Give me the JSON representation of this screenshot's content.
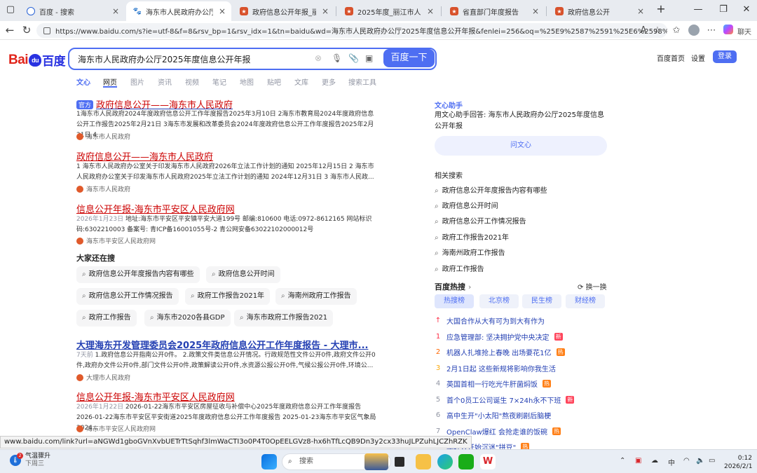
{
  "tabs": [
    {
      "title": "百度 - 搜索",
      "favicon": "search"
    },
    {
      "title": "海东市人民政府办公厅2025年度信息公开年报",
      "favicon": "baidu"
    },
    {
      "title": "政府信息公开年报_丽江市人民政府",
      "favicon": "gov"
    },
    {
      "title": "2025年度_丽江市人民政府",
      "favicon": "gov"
    },
    {
      "title": "省直部门年度报告",
      "favicon": "gov"
    },
    {
      "title": "政府信息公开",
      "favicon": "gov"
    }
  ],
  "address": {
    "url": "https://www.baidu.com/s?ie=utf-8&f=8&rsv_bp=1&rsv_idx=1&tn=baidu&wd=海东市人民政府办公厅2025年度信息公开年报&fenlei=256&oq=%25E9%2587%2591%25E6%2598%258C%25..."
  },
  "header": {
    "logo_text": "Bai",
    "logo_paw": "du",
    "logo_zh": "百度",
    "query": "海东市人民政府办公厅2025年度信息公开年报",
    "search_button": "百度一下",
    "home_link": "百度首页",
    "settings_link": "设置",
    "login_button": "登录"
  },
  "nav_tabs": [
    "文心",
    "网页",
    "图片",
    "资讯",
    "视频",
    "笔记",
    "地图",
    "贴吧",
    "文库",
    "更多",
    "搜索工具"
  ],
  "results": [
    {
      "badge": "官方",
      "title": "政府信息公开——海东市人民政府",
      "desc": "1海东市人民政府2024年度政府信息公开工作年度报告2025年3月10日 2海东市教育局2024年度政府信息公开工作报告2025年2月21日 3海东市发展和改革委员会2024年度政府信息公开工作年度报告2025年2月21日 4...",
      "source": "海东市人民政府"
    },
    {
      "title": "政府信息公开——海东市人民政府",
      "desc": "1 海东市人民政府办公室关于印发海东市人民政府2026年立法工作计划的通知 2025年12月15日 2 海东市人民政府办公室关于印发海东市人民政府2025年立法工作计划的通知 2024年12月31日 3 海东市人民政...",
      "source": "海东市人民政府"
    },
    {
      "title": "信息公开年报-海东市平安区人民政府网",
      "date": "2026年1月23日",
      "desc": "地址:海东市平安区平安镇平安大道199号 邮编:810600 电话:0972-8612165 网站标识码:6302210003 备案号: 青ICP备16001055号-2 青公网安备63022102000012号",
      "source": "海东市平安区人民政府网"
    },
    {
      "title": "大理海东开发管理委员会2025年政府信息公开工作年度报告 - 大理市...",
      "date": "7天前",
      "desc": "1.政府信息公开指南公开0件。 2.政策文件类信息公开情况。行政规范性文件公开0件,政府文件公开0件,政府办文件公开0件,部门文件公开0件,政策解读公开0件,水资源公报公开0件,气候公报公开0件,环境公...",
      "source": "大理市人民政府"
    },
    {
      "title": "信息公开年报-海东市平安区人民政府网",
      "date": "2026年1月22日",
      "desc": "2026-01-22海东市平安区房屋征收与补偿中心2025年度政府信息公开工作年度报告 2026-01-22海东市平安区平安街道2025年度政府信息公开工作年度报告 2025-01-23海东市平安区气象局2024...",
      "source": "海东市平安区人民政府网"
    }
  ],
  "also_searched": {
    "label": "大家还在搜",
    "items": [
      "政府信息公开年度报告内容有哪些",
      "政府信息公开时间",
      "政府信息公开工作情况报告",
      "政府工作报告2021年",
      "海南州政府工作报告",
      "政府工作报告",
      "海东市2020各县GDP",
      "海东市政府工作报告2021"
    ]
  },
  "wenxin": {
    "label": "文心助手",
    "text": "用文心助手回答: 海东市人民政府办公厅2025年度信息公开年报",
    "button": "问文心"
  },
  "related": {
    "label": "相关搜索",
    "items": [
      "政府信息公开年度报告内容有哪些",
      "政府信息公开时间",
      "政府信息公开工作情况报告",
      "政府工作报告2021年",
      "海南州政府工作报告",
      "政府工作报告"
    ]
  },
  "hot": {
    "label": "百度热搜",
    "swap": "换一换",
    "tabs": [
      "热搜榜",
      "北京榜",
      "民生榜",
      "财经榜"
    ],
    "items": [
      {
        "rank": "↑",
        "text": "大国合作从大有可为到大有作为",
        "tag": ""
      },
      {
        "rank": "1",
        "text": "应急管理部: 坚决拥护党中央决定",
        "tag": "新"
      },
      {
        "rank": "2",
        "text": "机器人扎堆抢上春晚 出场要花1亿",
        "tag": "热"
      },
      {
        "rank": "3",
        "text": "2月1日起 这些新规将影响你我生活",
        "tag": ""
      },
      {
        "rank": "4",
        "text": "英国首相一行吃光牛肝菌焖饭",
        "tag": "热"
      },
      {
        "rank": "5",
        "text": "首个0员工公司诞生 7×24h永不下班",
        "tag": "新"
      },
      {
        "rank": "6",
        "text": "高中生开\"小太阳\"熬夜刷剧后脑梗",
        "tag": ""
      },
      {
        "rank": "7",
        "text": "OpenClaw爆红 会抢走谁的饭碗",
        "tag": "热"
      },
      {
        "rank": "8",
        "text": "年轻人开始沉迷\"拼豆\"",
        "tag": "热"
      }
    ]
  },
  "status_url": "www.baidu.com/link?url=aNGWd1gboGVnXvbUETrTtSqhf3lmWaCTI3o0P4T0OpEELGVz8-hx6hTfLcQB9Dn3y2cx33huJLPZuhLJCZhRZK",
  "taskbar": {
    "weather_title": "气温骤升",
    "weather_sub": "下周三",
    "weather_badge": "2",
    "search_placeholder": "搜索",
    "ime": "中",
    "time": "0:12",
    "date": "2026/2/1",
    "copilot": "聊天"
  }
}
